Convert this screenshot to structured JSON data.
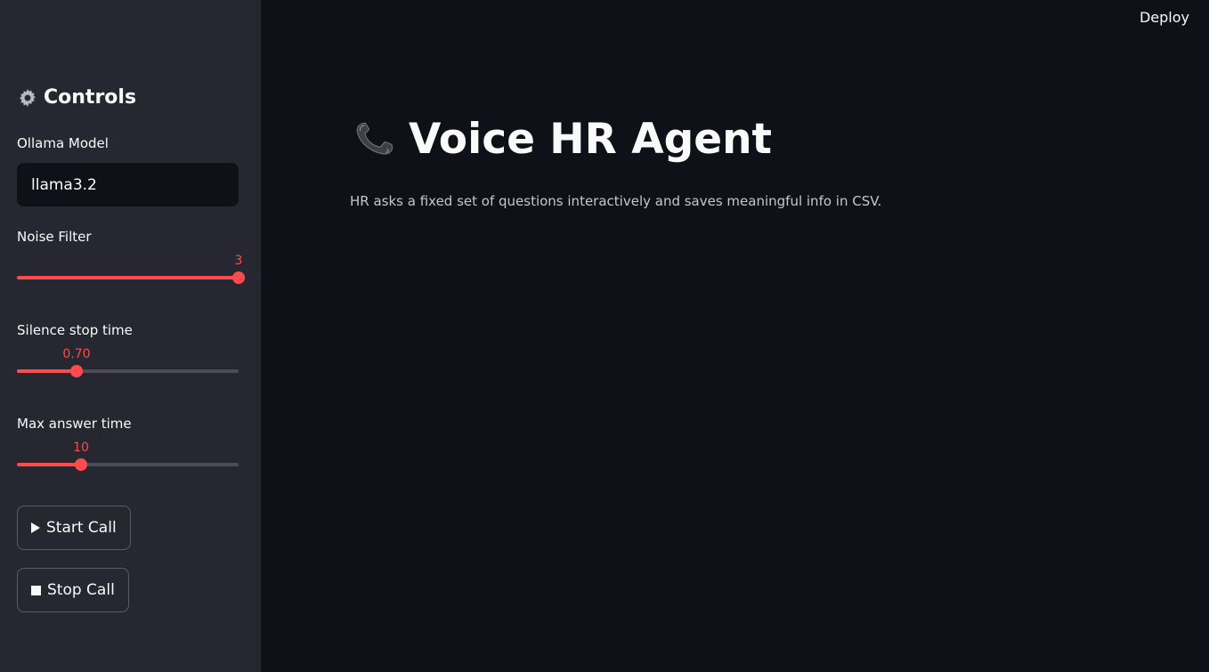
{
  "app": {
    "deploy_label": "Deploy"
  },
  "sidebar": {
    "header": "Controls",
    "header_icon": "gear-icon",
    "model": {
      "label": "Ollama Model",
      "value": "llama3.2"
    },
    "noise_filter": {
      "label": "Noise Filter",
      "value_text": "3",
      "fraction": 1.0
    },
    "silence_stop_time": {
      "label": "Silence stop time",
      "value_text": "0.70",
      "fraction": 0.27
    },
    "max_answer_time": {
      "label": "Max answer time",
      "value_text": "10",
      "fraction": 0.29
    },
    "start_button": {
      "label": "Start Call",
      "icon": "play-icon"
    },
    "stop_button": {
      "label": "Stop Call",
      "icon": "stop-icon"
    }
  },
  "main": {
    "title": "Voice HR Agent",
    "title_icon": "telephone-icon",
    "description": "HR asks a fixed set of questions interactively and saves meaningful info in CSV."
  },
  "colors": {
    "accent": "#ff4b4b",
    "sidebar_bg": "#262730",
    "main_bg": "#0e1117",
    "text": "#fafafa"
  }
}
